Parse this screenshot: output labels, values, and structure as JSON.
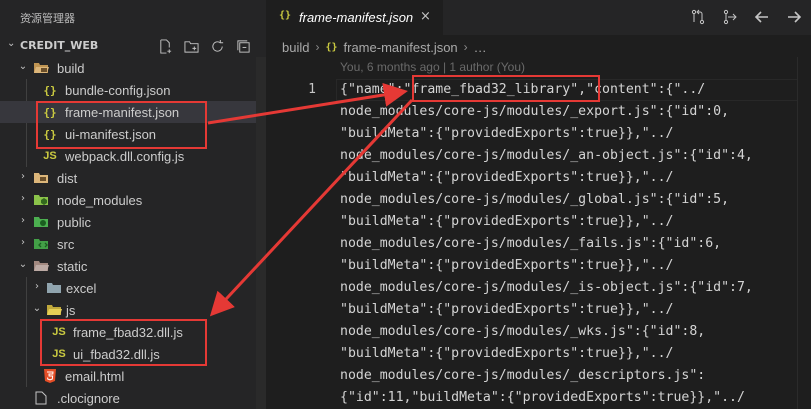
{
  "sidebar": {
    "title": "资源管理器",
    "more_icon": "ellipsis-icon",
    "section": {
      "name": "CREDIT_WEB",
      "actions": [
        "new-file-icon",
        "new-folder-icon",
        "refresh-icon",
        "collapse-all-icon"
      ]
    },
    "items": [
      {
        "label": "build",
        "type": "folder",
        "expanded": true
      },
      {
        "label": "bundle-config.json",
        "type": "json"
      },
      {
        "label": "frame-manifest.json",
        "type": "json"
      },
      {
        "label": "ui-manifest.json",
        "type": "json"
      },
      {
        "label": "webpack.dll.config.js",
        "type": "js"
      },
      {
        "label": "dist",
        "type": "folder",
        "expanded": false
      },
      {
        "label": "node_modules",
        "type": "folder",
        "expanded": false
      },
      {
        "label": "public",
        "type": "folder",
        "expanded": false
      },
      {
        "label": "src",
        "type": "folder",
        "expanded": false
      },
      {
        "label": "static",
        "type": "folder",
        "expanded": true
      },
      {
        "label": "excel",
        "type": "folder",
        "expanded": false
      },
      {
        "label": "js",
        "type": "folder",
        "expanded": true
      },
      {
        "label": "frame_fbad32.dll.js",
        "type": "js"
      },
      {
        "label": "ui_fbad32.dll.js",
        "type": "js"
      },
      {
        "label": "email.html",
        "type": "html"
      },
      {
        "label": ".clocignore",
        "type": "file"
      }
    ]
  },
  "editor": {
    "tab": {
      "label": "frame-manifest.json",
      "icon": "json-icon",
      "close": "×"
    },
    "actions": [
      "compare-changes-icon",
      "git-commit-icon",
      "go-back-icon",
      "go-forward-icon"
    ],
    "breadcrumb": [
      "build",
      "frame-manifest.json",
      "…"
    ],
    "blame": "You, 6 months ago | 1 author (You)",
    "line_number": "1",
    "lines": [
      "{\"name\":\"frame_fbad32_library\",\"content\":{\"../",
      "node_modules/core-js/modules/_export.js\":{\"id\":0,",
      "\"buildMeta\":{\"providedExports\":true}},\"../",
      "node_modules/core-js/modules/_an-object.js\":{\"id\":4,",
      "\"buildMeta\":{\"providedExports\":true}},\"../",
      "node_modules/core-js/modules/_global.js\":{\"id\":5,",
      "\"buildMeta\":{\"providedExports\":true}},\"../",
      "node_modules/core-js/modules/_fails.js\":{\"id\":6,",
      "\"buildMeta\":{\"providedExports\":true}},\"../",
      "node_modules/core-js/modules/_is-object.js\":{\"id\":7,",
      "\"buildMeta\":{\"providedExports\":true}},\"../",
      "node_modules/core-js/modules/_wks.js\":{\"id\":8,",
      "\"buildMeta\":{\"providedExports\":true}},\"../",
      "node_modules/core-js/modules/_descriptors.js\":",
      "{\"id\":11,\"buildMeta\":{\"providedExports\":true}},\"../"
    ]
  },
  "colors": {
    "annotation": "#e53935",
    "json_icon": "#cbcb41",
    "folder_icon": "#dcb67a"
  }
}
